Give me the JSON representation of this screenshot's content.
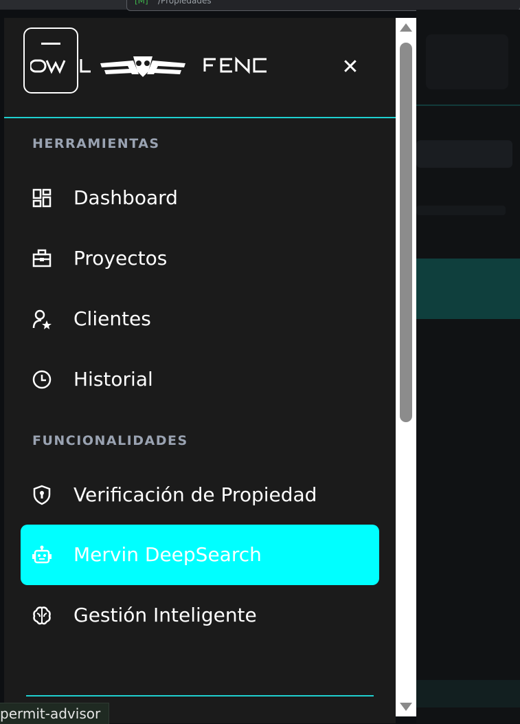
{
  "browser": {
    "url_badge": "[M]",
    "url_rest": "/Propiedades"
  },
  "drawer": {
    "brand_name": "OWL FENC",
    "close_icon": "close-icon",
    "sections": [
      {
        "title": "HERRAMIENTAS"
      },
      {
        "title": "FUNCIONALIDADES"
      }
    ],
    "items": [
      {
        "label": "Dashboard",
        "icon": "dashboard-icon",
        "active": false
      },
      {
        "label": "Proyectos",
        "icon": "briefcase-icon",
        "active": false
      },
      {
        "label": "Clientes",
        "icon": "user-star-icon",
        "active": false
      },
      {
        "label": "Historial",
        "icon": "clock-icon",
        "active": false
      },
      {
        "label": "Verificación de Propiedad",
        "icon": "shield-icon",
        "active": false
      },
      {
        "label": "Mervin DeepSearch",
        "icon": "robot-icon",
        "active": true
      },
      {
        "label": "Gestión Inteligente",
        "icon": "brain-icon",
        "active": false
      }
    ]
  },
  "status_bar": {
    "text": "permit-advisor"
  },
  "colors": {
    "accent": "#00ffff",
    "divider": "#1fd1d1",
    "drawer_bg": "#1b1b1b",
    "section_title": "#9aa3b2"
  }
}
